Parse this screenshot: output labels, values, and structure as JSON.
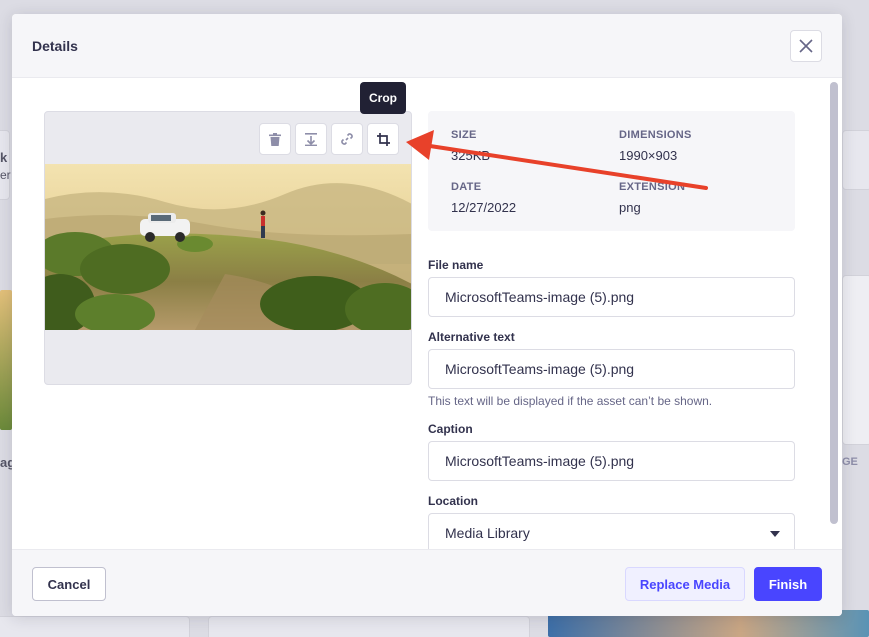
{
  "modal": {
    "title": "Details",
    "tooltip": "Crop"
  },
  "info": {
    "size_label": "SIZE",
    "size_value": "325KB",
    "dimensions_label": "DIMENSIONS",
    "dimensions_value": "1990×903",
    "date_label": "DATE",
    "date_value": "12/27/2022",
    "extension_label": "EXTENSION",
    "extension_value": "png"
  },
  "form": {
    "file_name_label": "File name",
    "file_name_value": "MicrosoftTeams-image (5).png",
    "alt_text_label": "Alternative text",
    "alt_text_value": "MicrosoftTeams-image (5).png",
    "alt_text_hint": "This text will be displayed if the asset can’t be shown.",
    "caption_label": "Caption",
    "caption_value": "MicrosoftTeams-image (5).png",
    "location_label": "Location",
    "location_value": "Media Library"
  },
  "footer": {
    "cancel": "Cancel",
    "replace": "Replace Media",
    "finish": "Finish"
  },
  "background": {
    "partial_text_1": "k",
    "partial_text_2": "er",
    "partial_text_3": "ag",
    "partial_text_4": "GE"
  },
  "icons": [
    "trash-icon",
    "download-icon",
    "link-icon",
    "crop-icon",
    "close-icon",
    "chevron-down-icon"
  ],
  "colors": {
    "primary": "#4945ff",
    "annotation_arrow": "#e8412a"
  }
}
